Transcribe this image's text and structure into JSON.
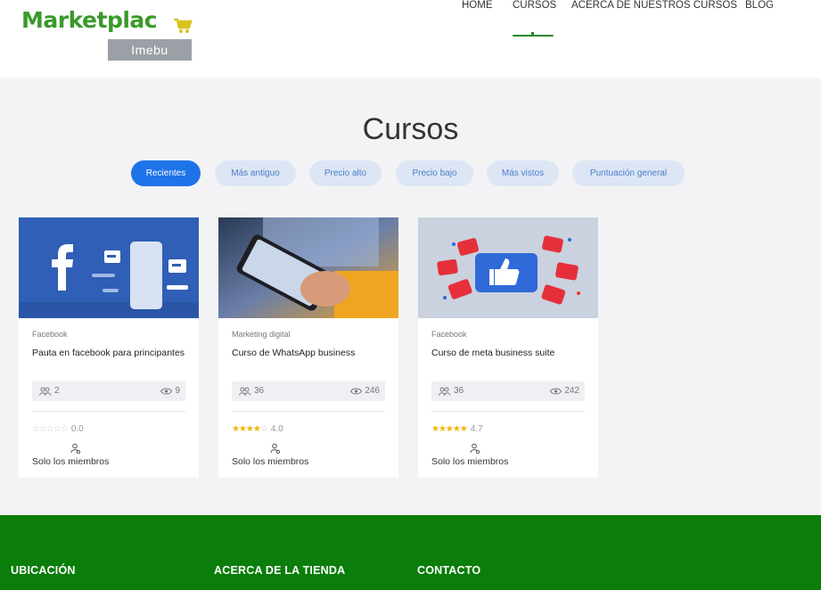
{
  "brand": {
    "name": "Marketplac",
    "sub": "Imebu",
    "accent": "#3a9a2a"
  },
  "nav": [
    {
      "label": "HOME"
    },
    {
      "label": "CURSOS",
      "active": true
    },
    {
      "label": "ACERCA DE NUESTROS CURSOS"
    },
    {
      "label": "BLOG"
    }
  ],
  "page": {
    "title": "Cursos"
  },
  "filters": [
    {
      "label": "Recientes",
      "active": true
    },
    {
      "label": "Más antiguo"
    },
    {
      "label": "Precio alto"
    },
    {
      "label": "Precio bajo"
    },
    {
      "label": "Más vistos"
    },
    {
      "label": "Puntuación general"
    }
  ],
  "courses": [
    {
      "category": "Facebook",
      "title": "Pauta en facebook para principantes",
      "members": "2",
      "views": "9",
      "rating": "0.0",
      "rating_value": 0,
      "access": "Solo los miembros",
      "thumb_icon": "facebook-icon"
    },
    {
      "category": "Marketing digital",
      "title": "Curso de WhatsApp business",
      "members": "36",
      "views": "246",
      "rating": "4.0",
      "rating_value": 4,
      "access": "Solo los miembros",
      "thumb_icon": "phone-photo"
    },
    {
      "category": "Facebook",
      "title": "Curso de meta business suite",
      "members": "36",
      "views": "242",
      "rating": "4.7",
      "rating_value": 4.7,
      "access": "Solo los miembros",
      "thumb_icon": "like-icon"
    }
  ],
  "footer": {
    "col1": "UBICACIÓN",
    "col2": "ACERCA DE LA TIENDA",
    "col3": "CONTACTO",
    "color": "#0b7d0b"
  }
}
